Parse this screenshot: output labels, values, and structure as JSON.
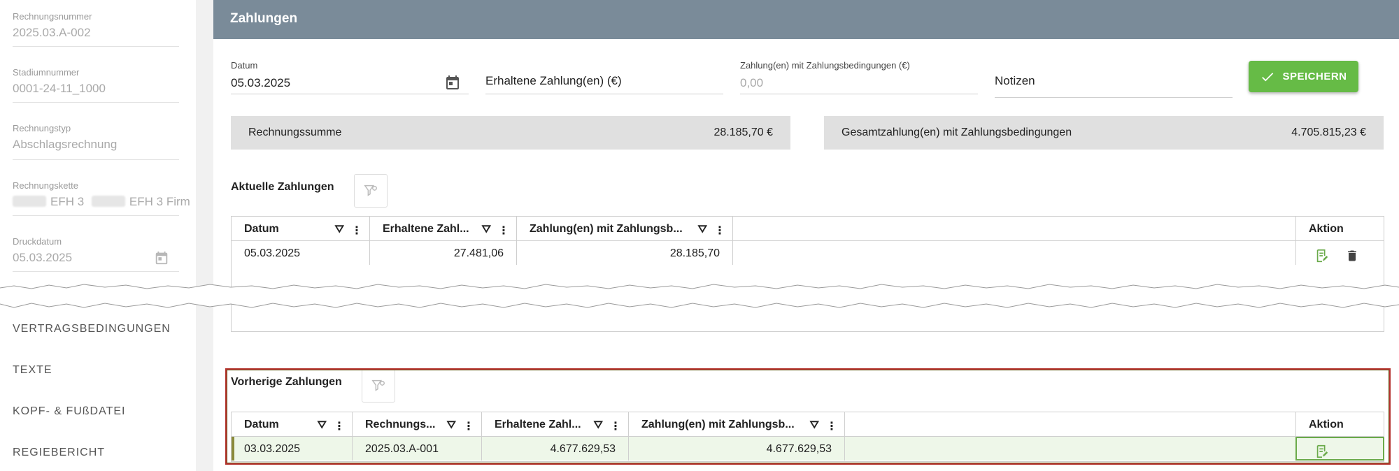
{
  "sidebar": {
    "fields": [
      {
        "label": "Rechnungsnummer",
        "value": "2025.03.A-002"
      },
      {
        "label": "Stadiumnummer",
        "value": "0001-24-11_1000"
      },
      {
        "label": "Rechnungstyp",
        "value": "Abschlagsrechnung"
      },
      {
        "label": "Rechnungskette",
        "value_part1": "EFH 3",
        "value_part2": "EFH 3 Firm"
      },
      {
        "label": "Druckdatum",
        "value": "05.03.2025"
      }
    ],
    "menu": [
      "VERTRAGSBEDINGUNGEN",
      "TEXTE",
      "KOPF- & FUßDATEI",
      "REGIEBERICHT"
    ]
  },
  "header": {
    "title": "Zahlungen"
  },
  "form": {
    "date_label": "Datum",
    "date_value": "05.03.2025",
    "received_placeholder": "Erhaltene Zahlung(en) (€)",
    "terms_label": "Zahlung(en) mit Zahlungsbedingungen (€)",
    "terms_value": "0,00",
    "notes_placeholder": "Notizen",
    "save_label": "SPEICHERN"
  },
  "summary": {
    "invoice_total_label": "Rechnungssumme",
    "invoice_total_value": "28.185,70 €",
    "total_payments_label": "Gesamtzahlung(en) mit Zahlungsbedingungen",
    "total_payments_value": "4.705.815,23 €"
  },
  "current": {
    "title": "Aktuelle Zahlungen",
    "headers": [
      "Datum",
      "Erhaltene Zahl...",
      "Zahlung(en) mit Zahlungsb...",
      "Aktion"
    ],
    "row": {
      "date": "05.03.2025",
      "received": "27.481,06",
      "terms": "28.185,70"
    }
  },
  "previous": {
    "title": "Vorherige Zahlungen",
    "headers": [
      "Datum",
      "Rechnungs...",
      "Erhaltene Zahl...",
      "Zahlung(en) mit Zahlungsb...",
      "Aktion"
    ],
    "row": {
      "date": "03.03.2025",
      "invoice": "2025.03.A-001",
      "received": "4.677.629,53",
      "terms": "4.677.629,53"
    }
  },
  "icons": {
    "calendar": "calendar-icon",
    "check": "check-icon",
    "filter": "filter-icon",
    "menu": "kebab-menu-icon",
    "edit": "edit-note-icon",
    "delete": "trash-icon"
  },
  "colors": {
    "header": "#7a8b99",
    "save": "#66bb46",
    "highlight_row": "#eef7e9",
    "highlight_border": "#b5322e"
  }
}
